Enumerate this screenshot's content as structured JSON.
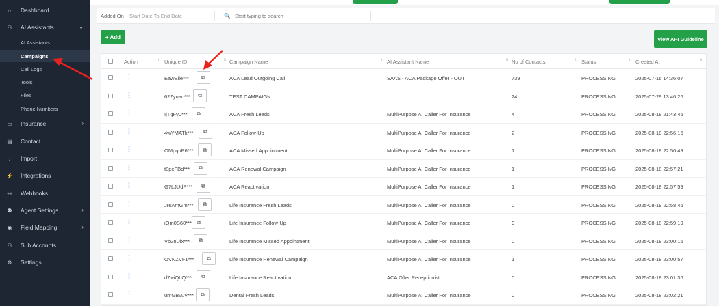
{
  "sidebar": {
    "items": [
      {
        "label": "Dashboard",
        "icon": "home-icon",
        "glyph": "⌂"
      },
      {
        "label": "AI Assistants",
        "icon": "user-icon",
        "glyph": "⚇",
        "chevron": "⌄"
      },
      {
        "label": "Insurance",
        "icon": "card-icon",
        "glyph": "▭",
        "chevron": "›"
      },
      {
        "label": "Contact",
        "icon": "contact-icon",
        "glyph": "▤"
      },
      {
        "label": "Import",
        "icon": "import-icon",
        "glyph": "↓"
      },
      {
        "label": "Integrations",
        "icon": "plug-icon",
        "glyph": "⚡"
      },
      {
        "label": "Webhooks",
        "icon": "webhook-icon",
        "glyph": "⚯"
      },
      {
        "label": "Agent Settings",
        "icon": "team-icon",
        "glyph": "⚉",
        "chevron": "›"
      },
      {
        "label": "Field Mapping",
        "icon": "database-icon",
        "glyph": "◉",
        "chevron": "›"
      },
      {
        "label": "Sub Accounts",
        "icon": "user-icon",
        "glyph": "⚇"
      },
      {
        "label": "Settings",
        "icon": "gear-icon",
        "glyph": "⚙"
      }
    ],
    "sub_items": [
      {
        "label": "AI Assistants"
      },
      {
        "label": "Campaigns"
      },
      {
        "label": "Call Logs"
      },
      {
        "label": "Tools"
      },
      {
        "label": "Files"
      },
      {
        "label": "Phone Numbers"
      }
    ]
  },
  "filter": {
    "added_on_label": "Added On",
    "date_range": "Start Date To End Date",
    "search_placeholder": "Start typing to search",
    "search_glyph": "🔍"
  },
  "actions": {
    "add_label": "+ Add",
    "api_label": "View API Guideline"
  },
  "table": {
    "headers": [
      "Action",
      "Unique ID",
      "Campaign Name",
      "AI Assistant Name",
      "No of Contacts",
      "Status",
      "Created At"
    ],
    "kebab_glyph": "⋮",
    "copy_glyph": "⧉",
    "sort_glyph": "⇅",
    "rows": [
      {
        "id": "EawElie***",
        "name": "ACA Lead Outgoing Call",
        "assistant": "SAAS - ACA Package Offer - OUT",
        "contacts": "739",
        "status": "PROCESSING",
        "created": "2025-07-16 14:36:07"
      },
      {
        "id": "62Zyuac***",
        "name": "TEST CAMPAIGN",
        "assistant": "",
        "contacts": "24",
        "status": "PROCESSING",
        "created": "2025-07-29 13:46:26"
      },
      {
        "id": "IjTgFy0***",
        "name": "ACA Fresh Leads",
        "assistant": "MultiPurpose AI Caller For Insurance",
        "contacts": "4",
        "status": "PROCESSING",
        "created": "2025-08-18 21:43:46"
      },
      {
        "id": "4wYMATk***",
        "name": "ACA Follow-Up",
        "assistant": "MultiPurpose AI Caller For Insurance",
        "contacts": "2",
        "status": "PROCESSING",
        "created": "2025-08-18 22:56:16"
      },
      {
        "id": "OMpqnP6***",
        "name": "ACA Missed Appointment",
        "assistant": "MultiPurpose AI Caller For Insurance",
        "contacts": "1",
        "status": "PROCESSING",
        "created": "2025-08-18 22:56:49"
      },
      {
        "id": "t8peFBd***",
        "name": "ACA Renewal Campaign",
        "assistant": "MultiPurpose AI Caller For Insurance",
        "contacts": "1",
        "status": "PROCESSING",
        "created": "2025-08-18 22:57:21"
      },
      {
        "id": "G7LJUdP***",
        "name": "ACA Reactivation",
        "assistant": "MultiPurpose AI Caller For Insurance",
        "contacts": "1",
        "status": "PROCESSING",
        "created": "2025-08-18 22:57:59"
      },
      {
        "id": "JreAmGm***",
        "name": "Life Insurance Fresh Leads",
        "assistant": "MultiPurpose AI Caller For Insurance",
        "contacts": "0",
        "status": "PROCESSING",
        "created": "2025-08-18 22:58:46"
      },
      {
        "id": "iQm0S60***",
        "name": "Life Insurance Follow-Up",
        "assistant": "MultiPurpose AI Caller For Insurance",
        "contacts": "0",
        "status": "PROCESSING",
        "created": "2025-08-18 22:59:19"
      },
      {
        "id": "Vb2nUix***",
        "name": "Life Insurance Missed Appointment",
        "assistant": "MultiPurpose AI Caller For Insurance",
        "contacts": "0",
        "status": "PROCESSING",
        "created": "2025-08-18 23:00:16"
      },
      {
        "id": "OVNZVF1***",
        "name": "Life Insurance Renewal Campaign",
        "assistant": "MultiPurpose AI Caller For Insurance",
        "contacts": "1",
        "status": "PROCESSING",
        "created": "2025-08-18 23:00:57"
      },
      {
        "id": "d7wiQLQ***",
        "name": "Life Insurance Reactivation",
        "assistant": "ACA Offer Receptionist",
        "contacts": "0",
        "status": "PROCESSING",
        "created": "2025-08-18 23:01:36"
      },
      {
        "id": "umGBvuV***",
        "name": "Dental Fresh Leads",
        "assistant": "MultiPurpose AI Caller For Insurance",
        "contacts": "0",
        "status": "PROCESSING",
        "created": "2025-08-18 23:02:21"
      }
    ]
  },
  "colors": {
    "sidebar_bg": "#1e2633",
    "accent_green": "#24a148",
    "annotation_red": "#e8231f"
  }
}
